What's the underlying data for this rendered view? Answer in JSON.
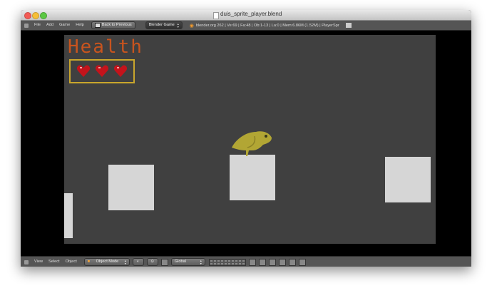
{
  "window": {
    "title": "duis_sprite_player.blend"
  },
  "header": {
    "menus": [
      "File",
      "Add",
      "Game",
      "Help"
    ],
    "back_button": "Back to Previous",
    "engine": "Blender Game",
    "stats": "blender.org 262 | Ve:69 | Fa:48 | Ob:1-13 | La:0 | Mem:6.86M (1.52M) | PlayerSpr"
  },
  "game": {
    "health_label": "Health",
    "hearts": 3,
    "colors": {
      "background": "#404040",
      "health_text": "#c8541e",
      "heart": "#c4131b",
      "heart_frame": "#c9a62c",
      "block": "#d6d6d6",
      "bird": "#b2a634"
    }
  },
  "footer": {
    "menus": [
      "View",
      "Select",
      "Object"
    ],
    "mode": "Object Mode",
    "orientation": "Global"
  }
}
